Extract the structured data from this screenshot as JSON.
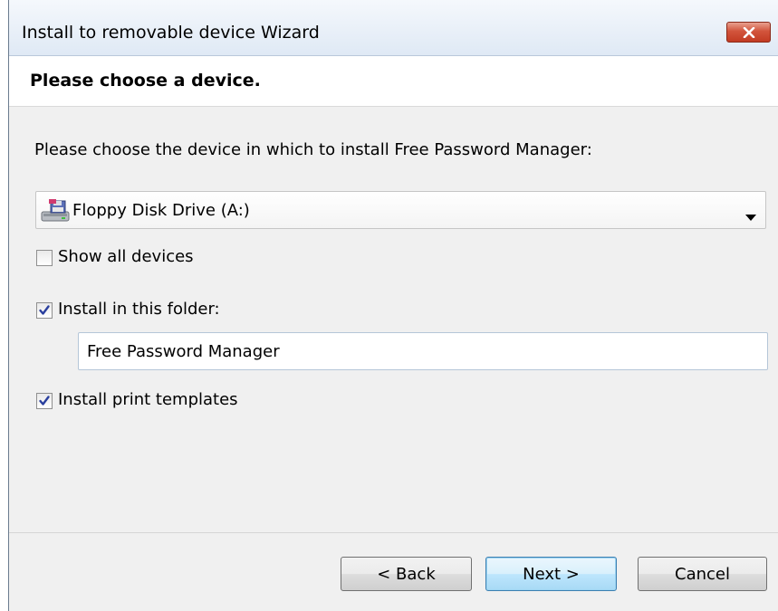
{
  "window": {
    "title": "Install to removable device Wizard"
  },
  "header": {
    "title": "Please choose a device."
  },
  "main": {
    "instruction": "Please choose the device in which to install Free Password Manager:",
    "device_select": {
      "selected": "Floppy Disk Drive (A:)",
      "icon": "floppy-drive-icon"
    },
    "show_all_devices": {
      "label": "Show all devices",
      "checked": false
    },
    "install_in_folder": {
      "label": "Install in this folder:",
      "checked": true
    },
    "folder_name": {
      "value": "Free Password Manager"
    },
    "install_print_templates": {
      "label": "Install print templates",
      "checked": true
    }
  },
  "footer": {
    "back_label": "< Back",
    "next_label": "Next >",
    "cancel_label": "Cancel"
  },
  "colors": {
    "close_button": "#c9452c",
    "default_button_border": "#3c7fb1",
    "window_background": "#f0f0f0"
  }
}
